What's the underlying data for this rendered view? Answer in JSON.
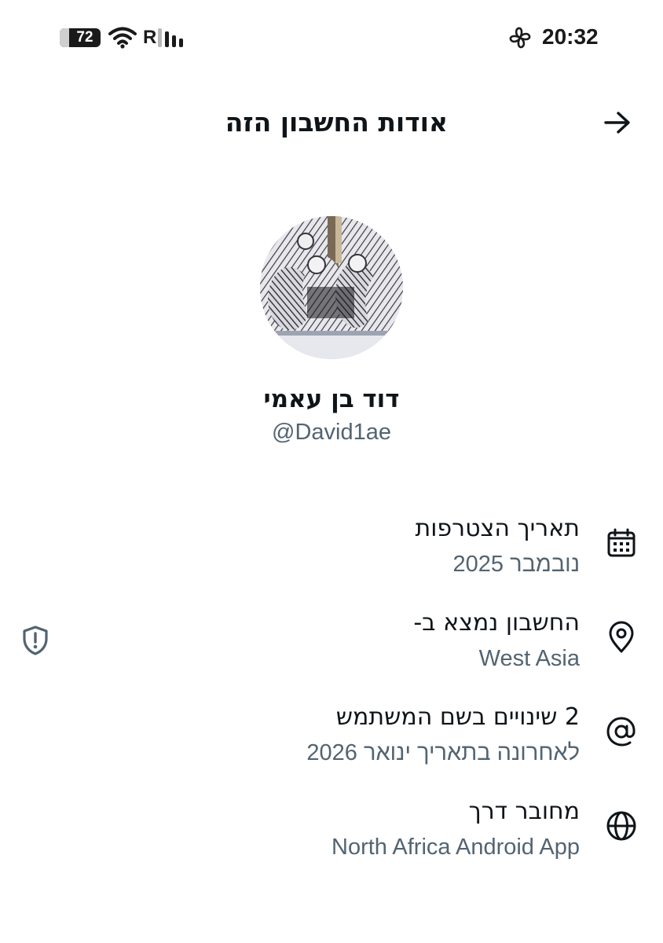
{
  "status_bar": {
    "battery_level": "72",
    "roaming_label": "R",
    "time": "20:32",
    "icons": [
      "battery-icon",
      "wifi-icon",
      "signal-icon",
      "fan-icon"
    ]
  },
  "header": {
    "title": "אודות החשבון הזה",
    "back_icon": "arrow-right-icon"
  },
  "profile": {
    "display_name": "דוד בן עאמי",
    "handle": "@David1ae"
  },
  "info": [
    {
      "icon": "calendar-icon",
      "title": "תאריך הצטרפות",
      "value": "נובמבר 2025"
    },
    {
      "icon": "location-pin-icon",
      "title": "החשבון נמצא ב-",
      "value": "West Asia"
    },
    {
      "icon": "at-sign-icon",
      "title": "2 שינויים בשם המשתמש",
      "value": "לאחרונה בתאריך ינואר 2026"
    },
    {
      "icon": "globe-icon",
      "title": "מחובר דרך",
      "value": "North Africa Android App"
    }
  ],
  "colors": {
    "text_primary": "#0f1419",
    "text_secondary": "#536471",
    "background": "#ffffff"
  }
}
